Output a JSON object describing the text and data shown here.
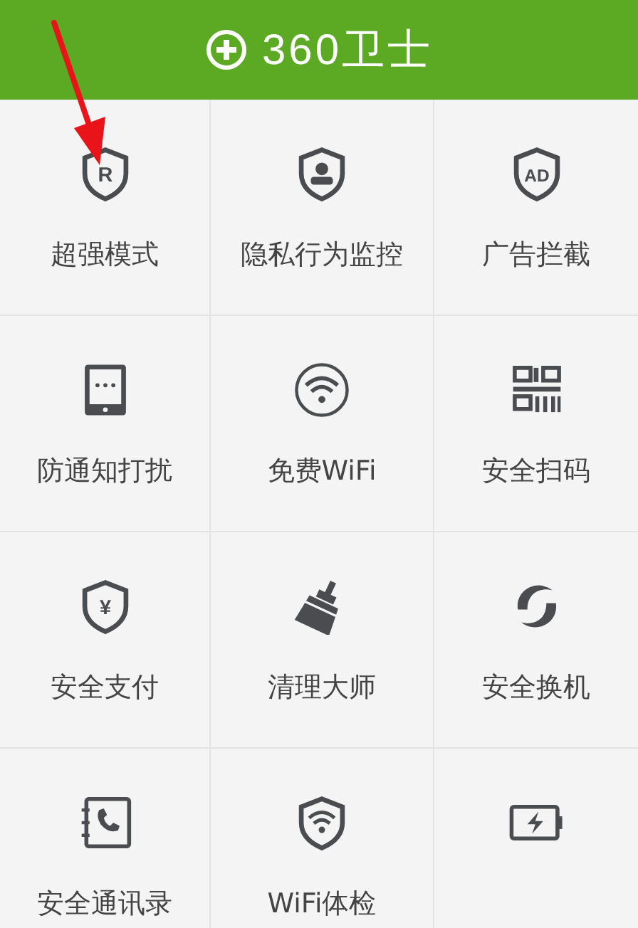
{
  "header": {
    "title": "360卫士"
  },
  "tiles": [
    {
      "kind": "feature",
      "mark": "R",
      "label": "超强模式"
    },
    {
      "kind": "feature",
      "label": "隐私行为监控"
    },
    {
      "kind": "feature",
      "mark": "AD",
      "label": "广告拦截"
    },
    {
      "kind": "feature",
      "label": "防通知打扰"
    },
    {
      "kind": "feature",
      "label": "免费WiFi"
    },
    {
      "kind": "feature",
      "label": "安全扫码"
    },
    {
      "kind": "feature",
      "mark": "¥",
      "label": "安全支付"
    },
    {
      "kind": "feature",
      "label": "清理大师"
    },
    {
      "kind": "feature",
      "label": "安全换机"
    },
    {
      "kind": "feature",
      "label": "安全通讯录"
    },
    {
      "kind": "feature",
      "label": "WiFi体检"
    },
    {
      "kind": "feature"
    }
  ],
  "annotation": {
    "kind": "arrow"
  }
}
